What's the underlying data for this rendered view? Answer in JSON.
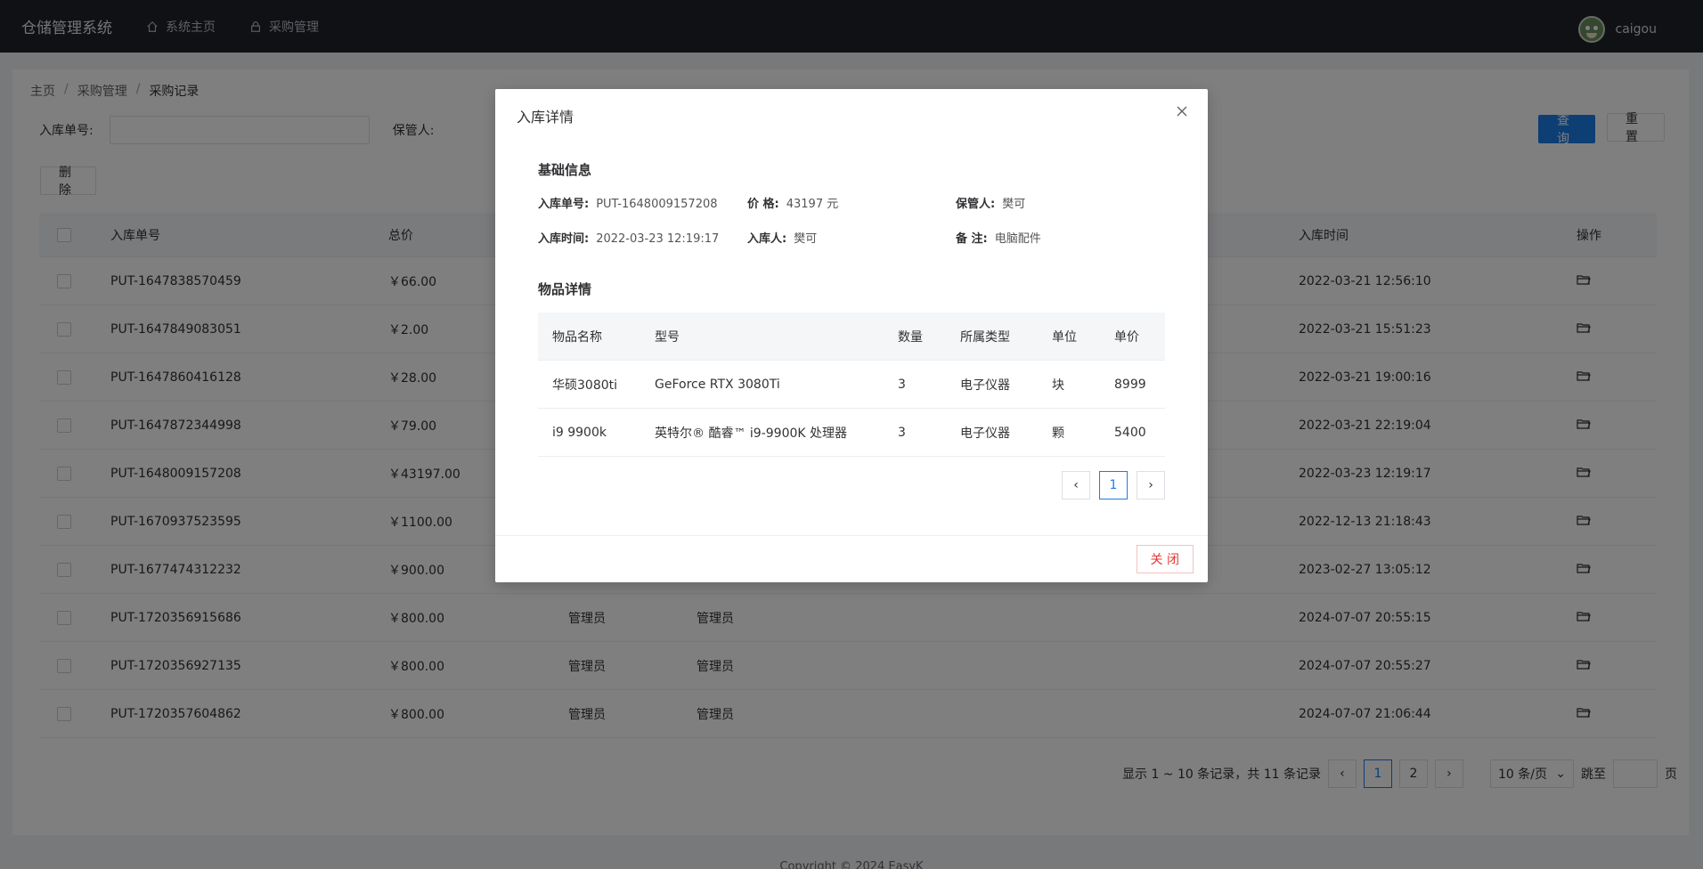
{
  "app": {
    "brand": "仓储管理系统",
    "nav": [
      {
        "label": "系统主页",
        "icon": "home-icon"
      },
      {
        "label": "采购管理",
        "icon": "lock-icon"
      }
    ],
    "user": {
      "name": "caigou"
    }
  },
  "breadcrumb": [
    "主页",
    "/",
    "采购管理",
    "/",
    "采购记录"
  ],
  "filters": {
    "order_label": "入库单号:",
    "keeper_label": "保管人:",
    "query_button": "查 询",
    "reset_button": "重 置",
    "delete_button": "删 除"
  },
  "table": {
    "headers": [
      "入库单号",
      "总价",
      "入库时间",
      "操作"
    ],
    "rows": [
      {
        "id": "PUT-1647838570459",
        "total": "￥66.00",
        "c3": "",
        "c4": "",
        "time": "2022-03-21 12:56:10"
      },
      {
        "id": "PUT-1647849083051",
        "total": "￥2.00",
        "c3": "",
        "c4": "",
        "time": "2022-03-21 15:51:23"
      },
      {
        "id": "PUT-1647860416128",
        "total": "￥28.00",
        "c3": "",
        "c4": "",
        "time": "2022-03-21 19:00:16"
      },
      {
        "id": "PUT-1647872344998",
        "total": "￥79.00",
        "c3": "",
        "c4": "",
        "time": "2022-03-21 22:19:04"
      },
      {
        "id": "PUT-1648009157208",
        "total": "￥43197.00",
        "c3": "",
        "c4": "",
        "time": "2022-03-23 12:19:17"
      },
      {
        "id": "PUT-1670937523595",
        "total": "￥1100.00",
        "c3": "",
        "c4": "",
        "time": "2022-12-13 21:18:43"
      },
      {
        "id": "PUT-1677474312232",
        "total": "￥900.00",
        "c3": "",
        "c4": "",
        "time": "2023-02-27 13:05:12"
      },
      {
        "id": "PUT-1720356915686",
        "total": "￥800.00",
        "c3": "管理员",
        "c4": "管理员",
        "time": "2024-07-07 20:55:15"
      },
      {
        "id": "PUT-1720356927135",
        "total": "￥800.00",
        "c3": "管理员",
        "c4": "管理员",
        "time": "2024-07-07 20:55:27"
      },
      {
        "id": "PUT-1720357604862",
        "total": "￥800.00",
        "c3": "管理员",
        "c4": "管理员",
        "time": "2024-07-07 21:06:44"
      }
    ]
  },
  "pagination": {
    "summary": "显示 1 ~ 10 条记录，共 11 条记录",
    "pages": [
      "1",
      "2"
    ],
    "page_size": "10 条/页",
    "jump_label": "跳至",
    "page_suffix": "页"
  },
  "footer": {
    "text": "Copyright © 2024 EasyK"
  },
  "modal": {
    "title": "入库详情",
    "basic_title": "基础信息",
    "fields": {
      "order_label": "入库单号:",
      "order_value": "PUT-1648009157208",
      "price_label": "价 格:",
      "price_value": "43197 元",
      "keeper_label": "保管人:",
      "keeper_value": "樊可",
      "time_label": "入库时间:",
      "time_value": "2022-03-23 12:19:17",
      "person_label": "入库人:",
      "person_value": "樊可",
      "note_label": "备 注:",
      "note_value": "电脑配件"
    },
    "items_title": "物品详情",
    "items_headers": [
      "物品名称",
      "型号",
      "数量",
      "所属类型",
      "单位",
      "单价"
    ],
    "items": [
      [
        "华硕3080ti",
        "GeForce RTX 3080Ti",
        "3",
        "电子仪器",
        "块",
        "8999"
      ],
      [
        "i9 9900k",
        "英特尔® 酷睿™ i9-9900K 处理器",
        "3",
        "电子仪器",
        "颗",
        "5400"
      ]
    ],
    "page": "1",
    "close_button": "关 闭"
  }
}
